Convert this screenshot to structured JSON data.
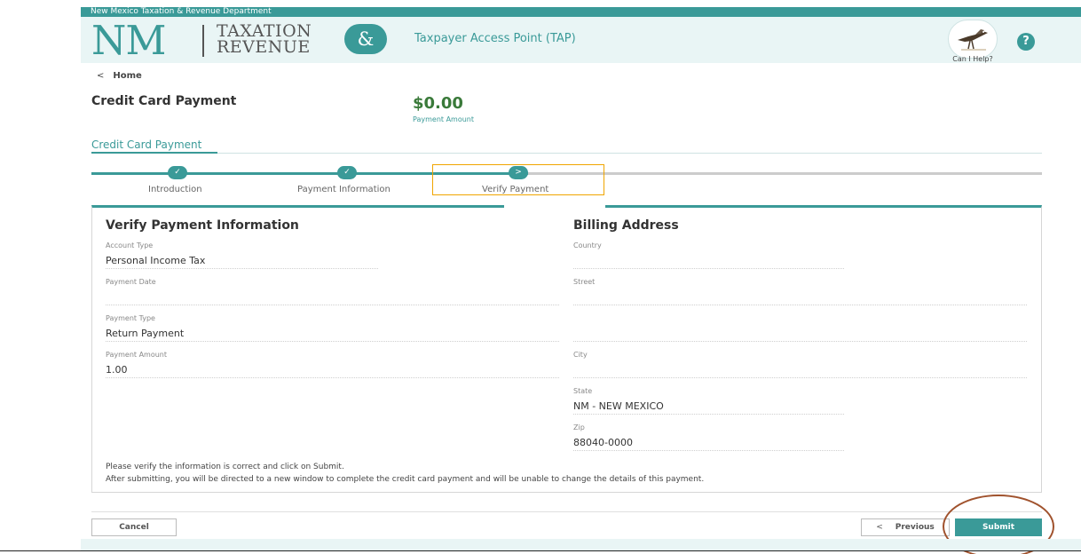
{
  "header": {
    "org": "New Mexico Taxation & Revenue Department",
    "logo_nm": "NM",
    "logo_line1": "TAXATION",
    "logo_line2": "REVENUE",
    "logo_amp": "&",
    "app_title": "Taxpayer Access Point (TAP)",
    "help_label": "Can I Help?",
    "help_icon_glyph": "?"
  },
  "breadcrumb": {
    "back": "<",
    "label": "Home"
  },
  "page": {
    "title": "Credit Card Payment",
    "amount": "$0.00",
    "amount_label": "Payment Amount"
  },
  "tabs": [
    {
      "label": "Credit Card Payment"
    }
  ],
  "steps": [
    {
      "label": "Introduction",
      "state": "done",
      "glyph": "✓"
    },
    {
      "label": "Payment Information",
      "state": "done",
      "glyph": "✓"
    },
    {
      "label": "Verify Payment",
      "state": "current",
      "glyph": ">"
    }
  ],
  "verify": {
    "title": "Verify Payment Information",
    "fields": [
      {
        "label": "Account Type",
        "value": "Personal Income Tax"
      },
      {
        "label": "Payment Date",
        "value": ""
      },
      {
        "label": "Payment Type",
        "value": "Return Payment"
      },
      {
        "label": "Payment Amount",
        "value": "1.00"
      }
    ]
  },
  "billing": {
    "title": "Billing Address",
    "fields": [
      {
        "label": "Country",
        "value": ""
      },
      {
        "label": "Street",
        "value": ""
      },
      {
        "label": "City",
        "value": ""
      },
      {
        "label": "State",
        "value": "NM - NEW MEXICO"
      },
      {
        "label": "Zip",
        "value": "88040-0000"
      }
    ]
  },
  "notes": [
    "Please verify the information is correct and click on Submit.",
    "After submitting, you will be directed to a new window to complete the credit card payment and will be unable to change the details of this payment."
  ],
  "buttons": {
    "cancel": "Cancel",
    "previous_chev": "<",
    "previous": "Previous",
    "submit": "Submit"
  },
  "colors": {
    "brand_teal": "#3a9a98",
    "header_bg": "#e9f5f5",
    "amount_green": "#3a7a3a",
    "highlight_orange": "#f0a500",
    "annotation_brown": "#a0522d"
  },
  "icons": {
    "back": "chevron-left-icon",
    "help": "question-circle-icon",
    "mascot": "roadrunner-icon",
    "step_done": "check-icon",
    "step_current": "chevron-right-icon"
  }
}
